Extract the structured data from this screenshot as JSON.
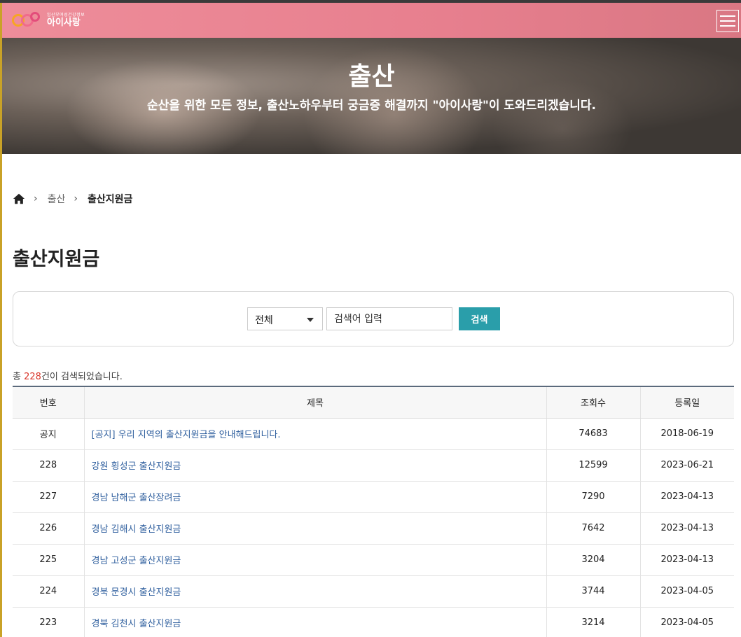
{
  "header": {
    "logo_small": "임산부여성건강정보",
    "logo_big": "아이사랑",
    "menu_icon": "hamburger-icon"
  },
  "hero": {
    "title": "출산",
    "subtitle": "순산을 위한 모든 정보, 출산노하우부터 궁금증 해결까지 \"아이사랑\"이 도와드리겠습니다."
  },
  "breadcrumb": {
    "home_icon": "home-icon",
    "items": [
      "출산",
      "출산지원금"
    ]
  },
  "page_title": "출산지원금",
  "search": {
    "select_value": "전체",
    "placeholder": "검색어 입력",
    "button_label": "검색"
  },
  "result": {
    "prefix": "총",
    "count": "228",
    "suffix": "건이 검색되었습니다."
  },
  "table": {
    "headers": [
      "번호",
      "제목",
      "조회수",
      "등록일"
    ],
    "rows": [
      {
        "no": "공지",
        "title": "[공지] 우리 지역의 출산지원금을 안내해드립니다.",
        "views": "74683",
        "date": "2018-06-19"
      },
      {
        "no": "228",
        "title": "강원 횡성군 출산지원금",
        "views": "12599",
        "date": "2023-06-21"
      },
      {
        "no": "227",
        "title": "경남 남해군 출산장려금",
        "views": "7290",
        "date": "2023-04-13"
      },
      {
        "no": "226",
        "title": "경남 김해시 출산지원금",
        "views": "7642",
        "date": "2023-04-13"
      },
      {
        "no": "225",
        "title": "경남 고성군 출산지원금",
        "views": "3204",
        "date": "2023-04-13"
      },
      {
        "no": "224",
        "title": "경북 문경시 출산지원금",
        "views": "3744",
        "date": "2023-04-05"
      },
      {
        "no": "223",
        "title": "경북 김천시 출산지원금",
        "views": "3214",
        "date": "2023-04-05"
      }
    ]
  }
}
